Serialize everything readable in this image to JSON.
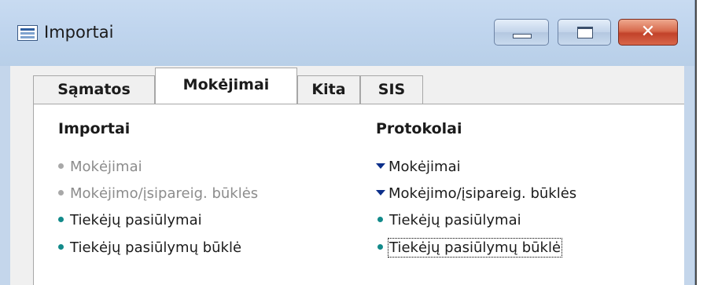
{
  "window": {
    "title": "Importai",
    "icon": "table-window-icon",
    "controls": {
      "minimize": "minimize-icon",
      "maximize": "maximize-icon",
      "close": "✕"
    }
  },
  "tabs": [
    {
      "label": "Sąmatos",
      "active": false
    },
    {
      "label": "Mokėjimai",
      "active": true
    },
    {
      "label": "Kita",
      "active": false
    },
    {
      "label": "SIS",
      "active": false
    }
  ],
  "sections": {
    "importai": {
      "title": "Importai",
      "items": [
        {
          "label": "Mokėjimai",
          "enabled": false
        },
        {
          "label": "Mokėjimo/įsipareig. būklės",
          "enabled": false
        },
        {
          "label": "Tiekėjų pasiūlymai",
          "enabled": true
        },
        {
          "label": "Tiekėjų pasiūlymų būklė",
          "enabled": true
        }
      ]
    },
    "protokolai": {
      "title": "Protokolai",
      "items": [
        {
          "label": "Mokėjimai",
          "type": "expandable"
        },
        {
          "label": "Mokėjimo/įsipareig. būklės",
          "type": "expandable"
        },
        {
          "label": "Tiekėjų pasiūlymai",
          "type": "link"
        },
        {
          "label": "Tiekėjų pasiūlymų būklė",
          "type": "link",
          "focused": true
        }
      ]
    }
  },
  "colors": {
    "title_bar": "#c4d6eb",
    "bullet_enabled": "#128a8a",
    "bullet_disabled": "#a8a8a8",
    "expand_arrow": "#0c2f8a",
    "disabled_text": "#8c8c8c",
    "close_button": "#c2422a"
  }
}
